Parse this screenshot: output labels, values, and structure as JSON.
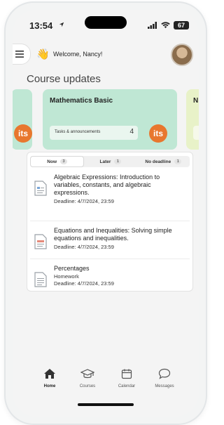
{
  "status": {
    "time": "13:54",
    "battery": "67"
  },
  "header": {
    "wave_emoji": "👋",
    "welcome": "Welcome, Nancy!"
  },
  "section_title": "Course updates",
  "cards": {
    "peek_left_logo": "its",
    "main": {
      "title": "Mathematics Basic",
      "tasks_label": "Tasks & announcements",
      "tasks_count": "4",
      "logo": "its"
    },
    "peek_right_title": "N"
  },
  "tabs": [
    {
      "label": "Now",
      "count": "3"
    },
    {
      "label": "Later",
      "count": "1"
    },
    {
      "label": "No deadline",
      "count": "1"
    }
  ],
  "items": [
    {
      "title": "Algebraic Expressions: Introduction to variables, constants, and algebraic expressions.",
      "deadline": "Deadline: 4/7/2024, 23:59"
    },
    {
      "title": "Equations and Inequalities: Solving simple equations and inequalities.",
      "deadline": "Deadline: 4/7/2024, 23:59"
    },
    {
      "title": "Percentages",
      "type": "Homework",
      "deadline": "Deadline: 4/7/2024, 23:59"
    }
  ],
  "nav": [
    {
      "label": "Home",
      "icon": "home-icon",
      "active": true
    },
    {
      "label": "Courses",
      "icon": "graduation-cap-icon"
    },
    {
      "label": "Calendar",
      "icon": "calendar-icon"
    },
    {
      "label": "Messages",
      "icon": "chat-bubble-icon"
    }
  ],
  "colors": {
    "card_green": "#bfe7d4",
    "card_yellow": "#e8f2c8",
    "logo_orange": "#e8772e"
  }
}
